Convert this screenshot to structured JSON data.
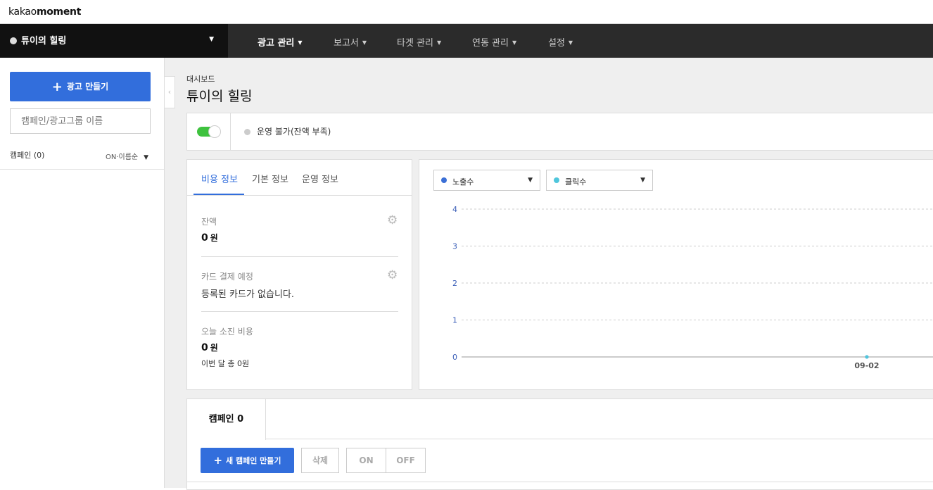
{
  "logo": {
    "light": "kakao",
    "bold": "moment"
  },
  "account": {
    "name": "튜이의 힐링",
    "caret": "▼"
  },
  "menu": [
    {
      "label": "광고 관리",
      "caret": "▼"
    },
    {
      "label": "보고서",
      "caret": "▼"
    },
    {
      "label": "타겟 관리",
      "caret": "▼"
    },
    {
      "label": "연동 관리",
      "caret": "▼"
    },
    {
      "label": "설정",
      "caret": "▼"
    }
  ],
  "sidebar": {
    "create_button": "광고 만들기",
    "search_placeholder": "캠페인/광고그룹 이름",
    "campaign_count": "캠페인 (0)",
    "sort_label": "ON·이름순",
    "collapse_icon": "‹"
  },
  "breadcrumb": "대시보드",
  "title": "튜이의 힐링",
  "status": {
    "text": "운영 불가(잔액 부족)",
    "toggle_on": true,
    "toggle_color": "#3ec23e",
    "dot_color": "#cccccc"
  },
  "cost_tabs": [
    "비용 정보",
    "기본 정보",
    "운영 정보"
  ],
  "cost": {
    "balance_label": "잔액",
    "balance_value": "0",
    "balance_unit": "원",
    "card_label": "카드 결제 예정",
    "card_value": "등록된 카드가 없습니다.",
    "today_label": "오늘 소진 비용",
    "today_value": "0",
    "today_unit": "원",
    "month_text": "이번 달 총 0원"
  },
  "chart_selectors": [
    {
      "label": "노출수",
      "color": "#3b6fd6"
    },
    {
      "label": "클릭수",
      "color": "#4fc6dc"
    }
  ],
  "chart_data": {
    "type": "line",
    "categories": [
      "09-02"
    ],
    "series": [
      {
        "name": "노출수",
        "values": [
          0
        ]
      },
      {
        "name": "클릭수",
        "values": [
          0
        ]
      }
    ],
    "yticks": [
      "0",
      "1",
      "2",
      "3",
      "4"
    ],
    "ylim": [
      0,
      4
    ],
    "grid": true
  },
  "campaign": {
    "tab": "캠페인 0",
    "new_button": "새 캠페인 만들기",
    "delete_button": "삭제",
    "on_button": "ON",
    "off_button": "OFF"
  },
  "colors": {
    "accent": "#326edc",
    "nav_bg": "#2b2b2b",
    "account_bg": "#111111"
  }
}
